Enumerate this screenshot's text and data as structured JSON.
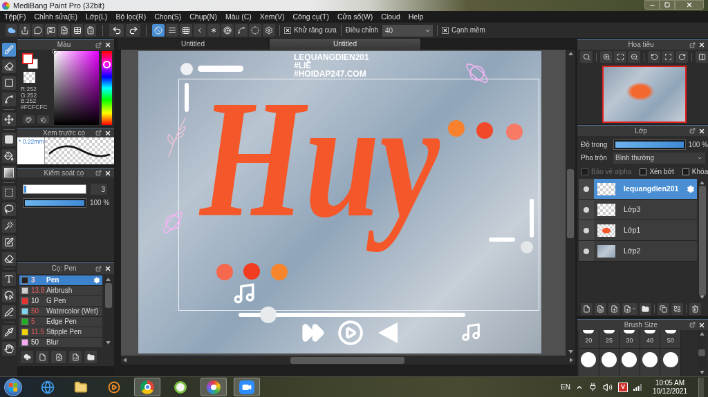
{
  "window": {
    "title": "MediBang Paint Pro (32bit)"
  },
  "menu": [
    "Tệp(F)",
    "Chỉnh sửa(E)",
    "Lớp(L)",
    "Bộ lọc(R)",
    "Chọn(S)",
    "Chụp(N)",
    "Màu (C)",
    "Xem(V)",
    "Công cụ(T)",
    "Cửa sổ(W)",
    "Cloud",
    "Help"
  ],
  "toolbar": {
    "snap_modes": [
      {
        "selected": true
      },
      {
        "selected": false
      },
      {
        "selected": false
      },
      {
        "selected": false
      },
      {
        "selected": false
      },
      {
        "selected": false
      },
      {
        "selected": false
      },
      {
        "selected": false
      },
      {
        "selected": false
      }
    ],
    "antialias": {
      "label": "Khử răng cưa",
      "checked": true
    },
    "correction": {
      "label": "Điều chỉnh",
      "value": "40"
    },
    "soft_edge": {
      "label": "Cạnh mềm",
      "checked": true
    }
  },
  "tools": [
    {
      "selected": true
    },
    {
      "selected": false
    },
    {
      "selected": false
    },
    {
      "selected": false
    },
    {
      "selected": false
    },
    {
      "selected": false
    },
    {
      "selected": false
    },
    {
      "selected": false
    },
    {
      "selected": false
    },
    {
      "selected": false
    },
    {
      "selected": false
    },
    {
      "selected": false
    },
    {
      "selected": false
    },
    {
      "selected": false
    },
    {
      "selected": false
    },
    {
      "selected": false
    },
    {
      "selected": false
    },
    {
      "selected": false
    }
  ],
  "color_panel": {
    "title": "Màu",
    "readouts": [
      "R:252",
      "G:252",
      "B:252",
      "#FCFCFC"
    ]
  },
  "brush_preview": {
    "title": "Xem trước cọ",
    "size": "* 0.22mm"
  },
  "brush_control": {
    "title": "Kiểm soát cọ",
    "size": {
      "level": 0.03,
      "value": "3"
    },
    "opacity": {
      "level": 1,
      "reading": "100 %"
    }
  },
  "brush_list": {
    "title": "Cọ: Pen",
    "items": [
      {
        "size": "3",
        "name": "Pen",
        "color": "#222222",
        "size_highlighted": true,
        "selected": true
      },
      {
        "size": "13.8",
        "name": "Airbrush",
        "color": "#d0d0d0",
        "size_highlighted": true,
        "selected": false
      },
      {
        "size": "10",
        "name": "G Pen",
        "color": "#e83030",
        "size_highlighted": false,
        "selected": false
      },
      {
        "size": "50",
        "name": "Watercolor (Wet)",
        "color": "#7fd6f2",
        "size_highlighted": true,
        "selected": false
      },
      {
        "size": "5",
        "name": "Edge Pen",
        "color": "#1fae1f",
        "size_highlighted": true,
        "selected": false
      },
      {
        "size": "11.5",
        "name": "Stipple Pen",
        "color": "#f0d400",
        "size_highlighted": true,
        "selected": false
      },
      {
        "size": "50",
        "name": "Blur",
        "color": "#f7a8f2",
        "size_highlighted": false,
        "selected": false
      }
    ]
  },
  "document": {
    "tabs": [
      {
        "label": "Untitled",
        "selected": false
      },
      {
        "label": "Untitled",
        "selected": true
      }
    ],
    "artwork": {
      "lettering": "Huy",
      "signature": [
        "LEQUANGDIEN201",
        "#LIE",
        "#HOIDAP247.COM"
      ]
    }
  },
  "navigator": {
    "title": "Hoa tiêu"
  },
  "layers": {
    "title": "Lớp",
    "opacity_label": "Độ trong",
    "opacity": {
      "level": 1,
      "reading": "100 %"
    },
    "blend_label": "Pha trộn",
    "blend": "Bình thường",
    "options": [
      {
        "label": "Bảo vệ alpha",
        "checked": false,
        "disabled": true
      },
      {
        "label": "Xén bớt",
        "checked": false,
        "disabled": false
      },
      {
        "label": "Khóa",
        "checked": false,
        "disabled": false
      }
    ],
    "items": [
      {
        "name": "lequangdien201",
        "kind": "transparent",
        "visible": true,
        "selected": true
      },
      {
        "name": "Lớp3",
        "kind": "transparent",
        "visible": true,
        "selected": false
      },
      {
        "name": "Lớp1",
        "kind": "lettering",
        "visible": true,
        "selected": false
      },
      {
        "name": "Lớp2",
        "kind": "photo",
        "visible": true,
        "selected": false
      }
    ]
  },
  "brush_size": {
    "title": "Brush Size",
    "sizes": [
      "20",
      "25",
      "30",
      "40",
      "50"
    ]
  },
  "taskbar": {
    "apps": [
      {
        "active": false
      },
      {
        "active": false
      },
      {
        "active": false
      },
      {
        "active": true
      },
      {
        "active": false
      },
      {
        "active": true
      },
      {
        "active": true
      }
    ],
    "language": "EN",
    "input_method": "V",
    "time": "10:05 AM",
    "date": "10/12/2021"
  }
}
